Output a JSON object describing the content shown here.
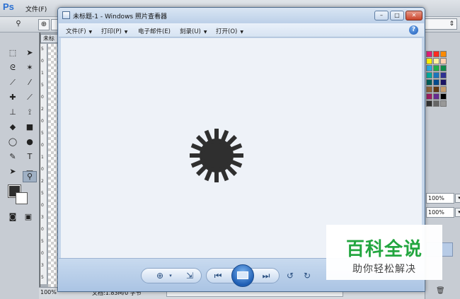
{
  "photoshop": {
    "logo": "Ps",
    "menu": [
      "文件(F)"
    ],
    "doc_tab": "未标",
    "ruler_marks": [
      "5",
      "0",
      "1",
      "5",
      "0",
      "2",
      "0",
      "5",
      "0",
      "1",
      "0",
      "2",
      "5",
      "0",
      "3",
      "0",
      "5",
      "0",
      "3",
      "5"
    ],
    "status": {
      "zoom": "100%",
      "doc_info": "文档:1.83M/0 字节"
    },
    "right_panel": {
      "dropdown_caret": "⇕",
      "zoom_top": "100%",
      "zoom_bottom": "100%"
    },
    "swatch_colors": [
      "#e0207a",
      "#ff2d20",
      "#ff8a00",
      "#fff200",
      "#fff2a0",
      "#ffd0b0",
      "#28a8e0",
      "#22b04a",
      "#0f8a4a",
      "#00a99d",
      "#1c75bc",
      "#2e3192",
      "#00605a",
      "#004b8c",
      "#1b1464",
      "#8c6239",
      "#603813",
      "#c69c6d",
      "#9e1f63",
      "#662d91",
      "#000000",
      "#333333",
      "#666666",
      "#999999"
    ],
    "fg_color": "#2e2e2e",
    "bg_color": "#ffffff"
  },
  "viewer": {
    "title": "未标题-1 - Windows 照片查看器",
    "menu": [
      {
        "label": "文件(F)",
        "caret": "▼"
      },
      {
        "label": "打印(P)",
        "caret": "▼"
      },
      {
        "label": "电子邮件(E)",
        "caret": ""
      },
      {
        "label": "刻录(U)",
        "caret": "▼"
      },
      {
        "label": "打开(O)",
        "caret": "▼"
      }
    ],
    "help": "?",
    "window_buttons": {
      "minimize": "–",
      "maximize": "□",
      "close": "✕"
    },
    "photo_color": "#2f2f2f",
    "background_color": "#eef2f8"
  },
  "watermark": {
    "main": "百科全说",
    "sub": "助你轻松解决"
  }
}
